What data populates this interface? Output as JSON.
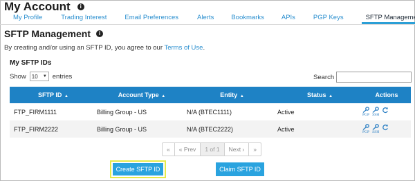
{
  "page": {
    "title": "My Account"
  },
  "tabs": [
    {
      "label": "My Profile"
    },
    {
      "label": "Trading Interest"
    },
    {
      "label": "Email Preferences"
    },
    {
      "label": "Alerts"
    },
    {
      "label": "Bookmarks"
    },
    {
      "label": "APIs"
    },
    {
      "label": "PGP Keys"
    },
    {
      "label": "SFTP Management"
    }
  ],
  "section": {
    "title": "SFTP Management",
    "agree_text": "By creating and/or using an SFTP ID, you agree to our",
    "terms_link": "Terms of Use",
    "terms_period": ".",
    "subtitle": "My SFTP IDs"
  },
  "controls": {
    "show_label": "Show",
    "entries_value": "10",
    "entries_label": "entries",
    "search_label": "Search"
  },
  "table": {
    "headers": [
      "SFTP ID",
      "Account Type",
      "Entity",
      "Status",
      "Actions"
    ],
    "rows": [
      {
        "sftp_id": "FTP_FIRM1111",
        "account_type": "Billing Group - US",
        "entity": "N/A (BTEC1111)",
        "status": "Active"
      },
      {
        "sftp_id": "FTP_FIRM2222",
        "account_type": "Billing Group - US",
        "entity": "N/A (BTEC2222)",
        "status": "Active"
      }
    ],
    "action_labels": {
      "pgp": "PGP",
      "ssh": "SSH"
    }
  },
  "pager": {
    "first": "«",
    "prev": "« Prev",
    "page": "1 of 1",
    "next": "Next ›",
    "last": "»"
  },
  "buttons": {
    "create": "Create SFTP ID",
    "claim": "Claim SFTP ID"
  },
  "colors": {
    "header_bg": "#1e82c5",
    "accent": "#2aa3df",
    "link": "#2b8fcf",
    "highlight": "#e6ea4a"
  }
}
